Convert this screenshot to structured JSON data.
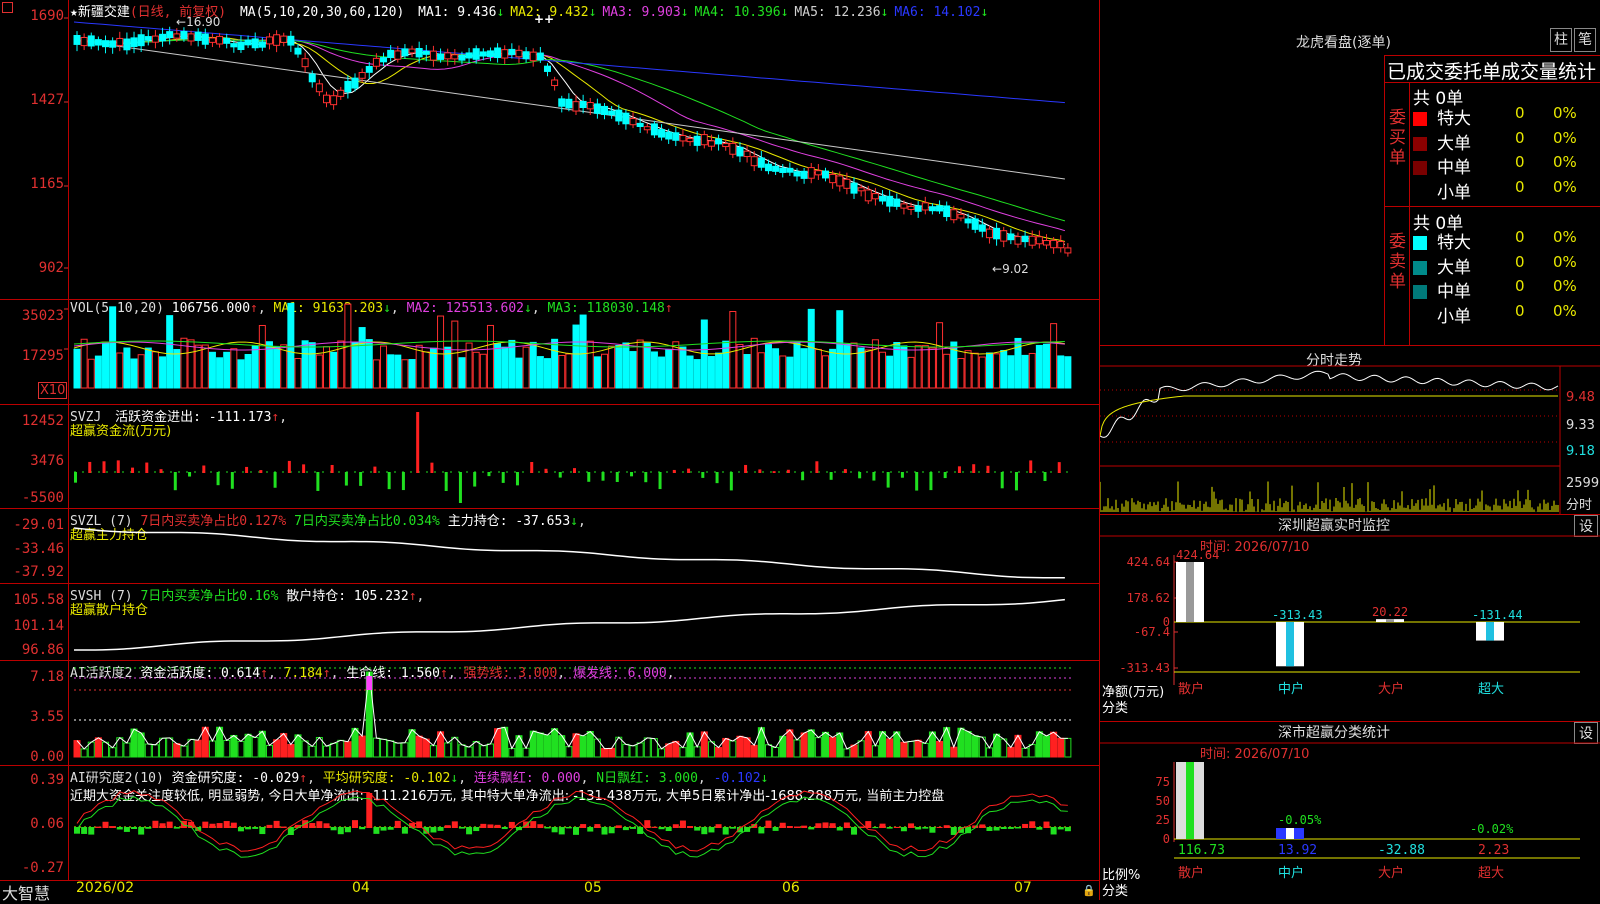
{
  "app": {
    "name": "大智慧"
  },
  "main": {
    "stock": "★新疆交建",
    "period": "(日线, 前复权)",
    "ma_label": "MA(5,10,20,30,60,120)",
    "ma_items": [
      {
        "label": "MA1:",
        "value": "9.436",
        "color": "#ffffff"
      },
      {
        "label": "MA2:",
        "value": "9.432",
        "color": "#e8e800"
      },
      {
        "label": "MA3:",
        "value": "9.903",
        "color": "#e040e0"
      },
      {
        "label": "MA4:",
        "value": "10.396",
        "color": "#20e020"
      },
      {
        "label": "MA5:",
        "value": "12.236",
        "color": "#d0d0d0"
      },
      {
        "label": "MA6:",
        "value": "14.102",
        "color": "#2a38ff"
      }
    ],
    "yticks": [
      "1690",
      "1427",
      "1165",
      "902"
    ],
    "high_note": "16.90",
    "low_note": "9.02",
    "cross_note": "++"
  },
  "vol": {
    "label": "VOL(5,10,20)",
    "value": "106756.000",
    "ma1": "MA1: 91632.203",
    "ma2": "MA2: 125513.602",
    "ma3": "MA3: 118030.148",
    "yticks": [
      "35023",
      "17295"
    ],
    "unit": "X10"
  },
  "svzj": {
    "label": "SVZJ",
    "title": "活跃资金进出: -111.173",
    "sub": "超赢资金流(万元)",
    "yticks": [
      "12452",
      "3476",
      "-5500"
    ]
  },
  "svzl": {
    "label": "SVZL (7)",
    "a": "7日内买卖净占比0.127%",
    "b": "7日内买卖净占比0.034%",
    "c": "主力持仓: -37.653",
    "sub": "超赢主力持仓",
    "yticks": [
      "-29.01",
      "-33.46",
      "-37.92"
    ]
  },
  "svsh": {
    "label": "SVSH (7)",
    "a": "7日内买卖净占比0.16%",
    "c": "散户持仓: 105.232",
    "sub": "超赢散户持仓",
    "yticks": [
      "105.58",
      "101.14",
      "96.86"
    ]
  },
  "ai1": {
    "label": "AI活跃度2",
    "a": "资金活跃度: 0.614",
    "b": "7.184",
    "c": "生命线: 1.560",
    "d": "强势线: 3.000",
    "e": "爆发线: 6.000",
    "yticks": [
      "7.18",
      "3.55",
      "0.00"
    ]
  },
  "ai2": {
    "label": "AI研究度2(10)",
    "a": "资金研究度: -0.029",
    "b": "平均研究度: -0.102",
    "c": "连续飘红: 0.000",
    "d": "N日飘红: 3.000",
    "e": "-0.102",
    "note": "近期大资金关注度较低, 明显弱势, 今日大单净流出: -111.216万元, 其中特大单净流出: -131.438万元, 大单5日累计净出-1688.288万元, 当前主力控盘",
    "yticks": [
      "0.39",
      "0.06",
      "-0.27"
    ]
  },
  "dates": [
    "2026/02",
    "04",
    "05",
    "06",
    "07"
  ],
  "lhb": {
    "title": "龙虎看盘(逐单)",
    "btn1": "柱",
    "btn2": "笔",
    "header": "已成交委托单成交量统计",
    "buy_label": "委买单",
    "sell_label": "委卖单",
    "buy_total": "共 0单",
    "sell_total": "共 0单",
    "rows": [
      {
        "name": "特大",
        "count": "0",
        "pct": "0%"
      },
      {
        "name": "大单",
        "count": "0",
        "pct": "0%"
      },
      {
        "name": "中单",
        "count": "0",
        "pct": "0%"
      },
      {
        "name": "小单",
        "count": "0",
        "pct": "0%"
      }
    ],
    "buy_colors": [
      "#ff0000",
      "#8b0000",
      "#7a0000",
      ""
    ],
    "sell_colors": [
      "#00ffff",
      "#008b8b",
      "#007a7a",
      ""
    ]
  },
  "intraday": {
    "title": "分时走势",
    "yticks": [
      "9.48",
      "9.33",
      "9.18"
    ],
    "vol_tick": "2599",
    "vol_unit": "分时"
  },
  "monitor": {
    "title": "深圳超赢实时监控",
    "btn": "设",
    "time": "时间: 2026/07/10",
    "yticks": [
      "424.64",
      "178.62",
      "0",
      "-67.4",
      "-313.43"
    ],
    "ylabel": "净额(万元)",
    "xlabel": "分类",
    "cats": [
      "散户",
      "中户",
      "大户",
      "超大"
    ],
    "values": [
      "424.64",
      "-313.43",
      "20.22",
      "-131.44"
    ]
  },
  "classify": {
    "title": "深市超赢分类统计",
    "btn": "设",
    "time": "时间: 2026/07/10",
    "yticks": [
      "75",
      "50",
      "25",
      "0"
    ],
    "ylabel": "比例%",
    "xlabel": "分类",
    "cats": [
      "散户",
      "中户",
      "大户",
      "超大"
    ],
    "bottom_values": [
      "116.73",
      "13.92",
      "-32.88",
      "2.23"
    ],
    "pct_labels": [
      "-0.05%",
      "-0.02%"
    ]
  },
  "chart_data": [
    {
      "type": "candlestick",
      "title": "新疆交建",
      "yticks": [
        1690,
        1427,
        1165,
        902
      ],
      "trend": "decline from about 16.90 high to about 9.02 low"
    },
    {
      "type": "bar",
      "title": "深圳超赢实时监控",
      "categories": [
        "散户",
        "中户",
        "大户",
        "超大"
      ],
      "values": [
        424.64,
        -313.43,
        20.22,
        -131.44
      ],
      "ylabel": "净额(万元)"
    },
    {
      "type": "bar",
      "title": "深市超赢分类统计",
      "categories": [
        "散户",
        "中户",
        "大户",
        "超大"
      ],
      "values": [
        116.73,
        13.92,
        -32.88,
        2.23
      ],
      "ylabel": "比例%"
    }
  ]
}
